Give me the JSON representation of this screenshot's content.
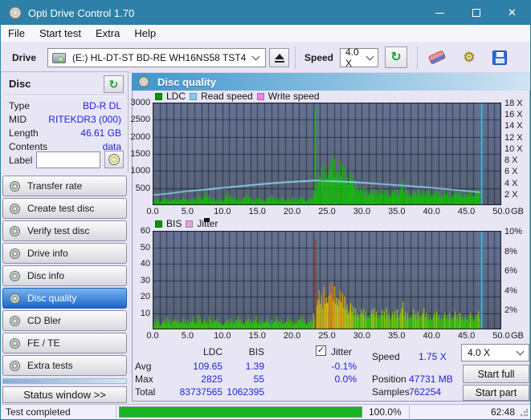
{
  "window": {
    "title": "Opti Drive Control 1.70",
    "close_glyph": "✕"
  },
  "menu": {
    "items": [
      "File",
      "Start test",
      "Extra",
      "Help"
    ]
  },
  "toolbar": {
    "drive_label": "Drive",
    "drive_value": "(E:)  HL-DT-ST BD-RE  WH16NS58 TST4",
    "speed_label": "Speed",
    "speed_value": "4.0 X"
  },
  "sidebar": {
    "header": "Disc",
    "fields": [
      {
        "label": "Type",
        "value": "BD-R DL"
      },
      {
        "label": "MID",
        "value": "RITEKDR3 (000)"
      },
      {
        "label": "Length",
        "value": "46.61 GB"
      },
      {
        "label": "Contents",
        "value": "data"
      }
    ],
    "label_field": {
      "label": "Label",
      "value": ""
    },
    "nav": [
      {
        "label": "Transfer rate"
      },
      {
        "label": "Create test disc"
      },
      {
        "label": "Verify test disc"
      },
      {
        "label": "Drive info"
      },
      {
        "label": "Disc info"
      },
      {
        "label": "Disc quality"
      },
      {
        "label": "CD Bler"
      },
      {
        "label": "FE / TE"
      },
      {
        "label": "Extra tests"
      }
    ],
    "active_nav_index": 5,
    "status_window_label": "Status window >>"
  },
  "panel": {
    "title": "Disc quality"
  },
  "stats": {
    "col_headers": {
      "ldc": "LDC",
      "bis": "BIS",
      "jitter": "Jitter"
    },
    "jitter_checked": "✓",
    "rows": [
      {
        "label": "Avg",
        "ldc": "109.65",
        "bis": "1.39",
        "jitter": "-0.1%"
      },
      {
        "label": "Max",
        "ldc": "2825",
        "bis": "55",
        "jitter": "0.0%"
      },
      {
        "label": "Total",
        "ldc": "83737565",
        "bis": "1062395",
        "jitter": ""
      }
    ],
    "info": [
      {
        "label": "Speed",
        "value": "1.75 X"
      },
      {
        "label": "Position",
        "value": "47731 MB"
      },
      {
        "label": "Samples",
        "value": "762254"
      }
    ],
    "speed_select": "4.0 X",
    "start_full": "Start full",
    "start_part": "Start part"
  },
  "statusbar": {
    "text": "Test completed",
    "percent": "100.0%",
    "progress_value": 100,
    "time": "62:48"
  },
  "colors": {
    "titlebar": "#2e80a8",
    "plot_bg_top": "#667293",
    "plot_bg_bottom": "#566177",
    "grid": "rgba(10,12,20,0.55)",
    "ldc_green": "#10c400",
    "read_speed": "#8fd8f6",
    "end_marker": "#35d2f2",
    "bis_spike_red": "#cc2020",
    "value_blue": "#2121dd"
  },
  "chart_data": [
    {
      "type": "bar+line",
      "name": "LDC / speed chart",
      "x_unit": "GB",
      "x_max": 50,
      "x_ticks": [
        "0.0",
        "5.0",
        "10.0",
        "15.0",
        "20.0",
        "25.0",
        "30.0",
        "35.0",
        "40.0",
        "45.0",
        "50.0"
      ],
      "legend": [
        {
          "label": "LDC",
          "color": "#089400"
        },
        {
          "label": "Read speed",
          "color": "#7fccee"
        },
        {
          "label": "Write speed",
          "color": "#ef82ef"
        }
      ],
      "y_left": {
        "max": 3000,
        "ticks": [
          3000,
          2500,
          2000,
          1500,
          1000,
          500
        ]
      },
      "y_right": {
        "max": 18,
        "tick_labels": [
          "18 X",
          "16 X",
          "14 X",
          "12 X",
          "10 X",
          "8 X",
          "6 X",
          "4 X",
          "2 X"
        ],
        "tick_values": [
          18,
          16,
          14,
          12,
          10,
          8,
          6,
          4,
          2
        ]
      },
      "bin_width_gb": 0.5,
      "bars": {
        "name": "LDC",
        "color": "#10c400",
        "values": [
          180,
          220,
          160,
          250,
          200,
          170,
          230,
          190,
          260,
          210,
          180,
          240,
          200,
          320,
          260,
          390,
          280,
          200,
          170,
          230,
          210,
          380,
          300,
          250,
          200,
          180,
          350,
          260,
          220,
          190,
          240,
          200,
          180,
          260,
          300,
          220,
          190,
          250,
          210,
          180,
          240,
          200,
          260,
          220,
          190,
          230,
          420,
          950,
          1100,
          1250,
          1300,
          1420,
          1350,
          1280,
          1150,
          1100,
          1000,
          880,
          720,
          600,
          560,
          500,
          520,
          470,
          450,
          500,
          430,
          460,
          420,
          440,
          480,
          750,
          520,
          450,
          420,
          400,
          500,
          430,
          410,
          440,
          420,
          400,
          430,
          390,
          410,
          380,
          400,
          430,
          390,
          370,
          400,
          380,
          430,
          460
        ]
      },
      "spikes": [
        {
          "x": 23.3,
          "value": 2825,
          "color": "#10c400"
        }
      ],
      "line": {
        "name": "Read speed",
        "color": "#8fd8f6",
        "axis": "right",
        "points": [
          [
            0,
            1.75
          ],
          [
            2,
            2.0
          ],
          [
            5,
            2.45
          ],
          [
            8,
            2.8
          ],
          [
            11,
            3.15
          ],
          [
            14,
            3.5
          ],
          [
            17,
            3.85
          ],
          [
            20,
            4.1
          ],
          [
            23,
            4.3
          ],
          [
            23.6,
            4.35
          ],
          [
            24,
            4.25
          ],
          [
            26,
            4.2
          ],
          [
            28,
            4.1
          ],
          [
            30,
            3.95
          ],
          [
            33,
            3.7
          ],
          [
            36,
            3.45
          ],
          [
            39,
            3.15
          ],
          [
            42,
            2.85
          ],
          [
            44,
            2.6
          ],
          [
            46,
            2.4
          ],
          [
            47,
            2.25
          ]
        ]
      },
      "end_marker": {
        "x": 47.15,
        "color": "#35d2f2"
      }
    },
    {
      "type": "bar",
      "name": "BIS / jitter chart",
      "x_unit": "GB",
      "x_max": 50,
      "x_ticks": [
        "0.0",
        "5.0",
        "10.0",
        "15.0",
        "20.0",
        "25.0",
        "30.0",
        "35.0",
        "40.0",
        "45.0",
        "50.0"
      ],
      "legend": [
        {
          "label": "BIS",
          "color": "#089400"
        },
        {
          "label": "Jitter",
          "color": "#d9a8d9"
        }
      ],
      "y_left": {
        "max": 60,
        "ticks": [
          60,
          50,
          40,
          30,
          20,
          10
        ]
      },
      "y_right": {
        "max": 10,
        "tick_labels": [
          "10%",
          "8%",
          "6%",
          "4%",
          "2%"
        ],
        "tick_values": [
          10,
          8,
          6,
          4,
          2
        ]
      },
      "bin_width_gb": 0.5,
      "bars": {
        "name": "BIS",
        "color": "by_value",
        "values": [
          5,
          7,
          4,
          6,
          8,
          5,
          7,
          6,
          7,
          5,
          6,
          8,
          5,
          9,
          6,
          5,
          8,
          6,
          7,
          5,
          4,
          6,
          7,
          5,
          8,
          6,
          5,
          7,
          6,
          8,
          5,
          6,
          7,
          5,
          6,
          8,
          6,
          5,
          7,
          6,
          5,
          6,
          8,
          7,
          5,
          6,
          10,
          24,
          21,
          26,
          27,
          29,
          26,
          24,
          22,
          20,
          16,
          14,
          13,
          12,
          13,
          11,
          12,
          13,
          11,
          12,
          11,
          13,
          10,
          11,
          12,
          17,
          11,
          10,
          12,
          10,
          11,
          13,
          10,
          9,
          10,
          11,
          9,
          10,
          9,
          10,
          11,
          9,
          10,
          9,
          8,
          10,
          9,
          11
        ],
        "color_scale": [
          {
            "max": 9,
            "color": "#2fcc00"
          },
          {
            "max": 14,
            "color": "#9ad400"
          },
          {
            "max": 20,
            "color": "#d7cb00"
          },
          {
            "max": 26,
            "color": "#eda400"
          },
          {
            "max": 60,
            "color": "#ee7700"
          }
        ]
      },
      "spikes": [
        {
          "x": 23.35,
          "value": 55,
          "color": "#cc2020"
        }
      ],
      "end_marker": {
        "x": 47.15,
        "color": "#35d2f2"
      }
    }
  ]
}
